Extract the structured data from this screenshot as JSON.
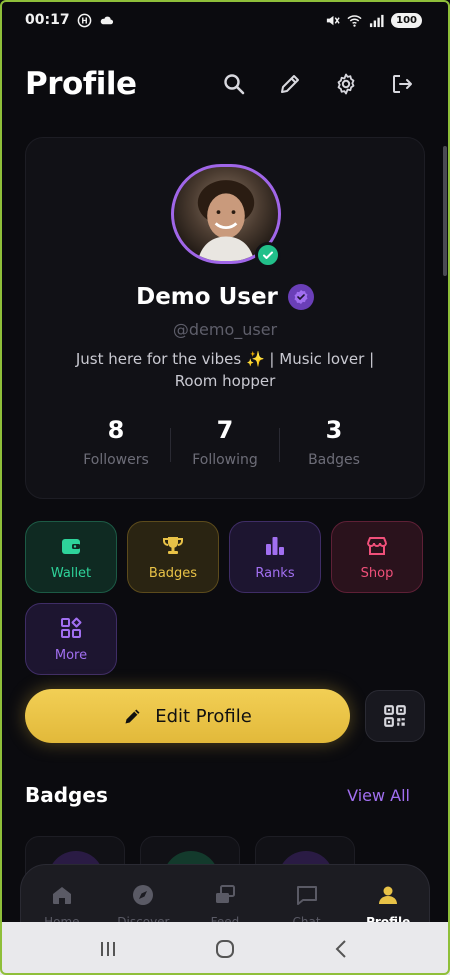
{
  "status_bar": {
    "time": "00:17",
    "battery": "100"
  },
  "header": {
    "title": "Profile"
  },
  "profile": {
    "name": "Demo User",
    "handle": "@demo_user",
    "bio": "Just here for the vibes ✨ | Music lover | Room hopper",
    "stats": [
      {
        "value": "8",
        "label": "Followers"
      },
      {
        "value": "7",
        "label": "Following"
      },
      {
        "value": "3",
        "label": "Badges"
      }
    ]
  },
  "quick_actions": [
    {
      "label": "Wallet",
      "icon": "wallet-icon",
      "color": "#2ed39a"
    },
    {
      "label": "Badges",
      "icon": "trophy-icon",
      "color": "#e8c247"
    },
    {
      "label": "Ranks",
      "icon": "bar-chart-icon",
      "color": "#a16ff0"
    },
    {
      "label": "Shop",
      "icon": "store-icon",
      "color": "#f0507a"
    },
    {
      "label": "More",
      "icon": "apps-icon",
      "color": "#a16ff0"
    }
  ],
  "edit_profile": {
    "label": "Edit Profile"
  },
  "badges_section": {
    "title": "Badges",
    "view_all": "View All"
  },
  "bottom_nav": [
    {
      "label": "Home",
      "icon": "home-icon",
      "active": false
    },
    {
      "label": "Discover",
      "icon": "compass-icon",
      "active": false
    },
    {
      "label": "Feed",
      "icon": "feed-icon",
      "active": false
    },
    {
      "label": "Chat",
      "icon": "chat-icon",
      "active": false
    },
    {
      "label": "Profile",
      "icon": "person-icon",
      "active": true
    }
  ],
  "colors": {
    "accent_purple": "#a16ff0",
    "accent_gold": "#e8c247",
    "online_green": "#22c08a"
  }
}
